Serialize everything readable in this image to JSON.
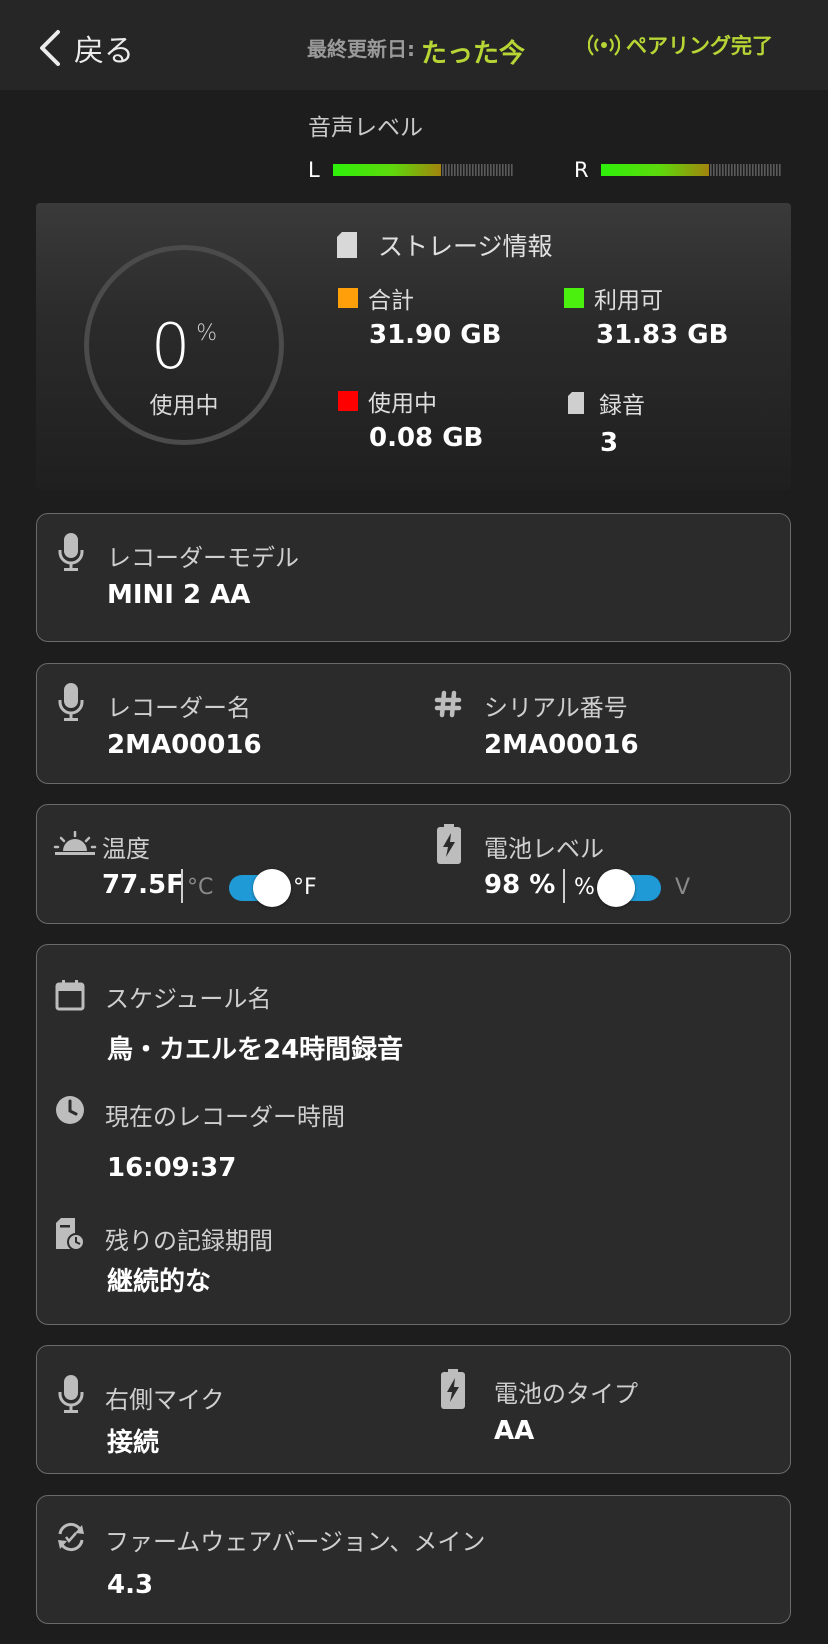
{
  "header": {
    "back_label": "戻る",
    "updated_label": "最終更新日:",
    "updated_value": "たった今",
    "pairing_status": "ペアリング完了",
    "accent_color": "#b7d635"
  },
  "audio": {
    "title": "音声レベル",
    "left_label": "L",
    "right_label": "R",
    "left_level": 0.6,
    "right_level": 0.6
  },
  "storage": {
    "used_percent": "0",
    "percent_unit": "%",
    "used_caption": "使用中",
    "title": "ストレージ情報",
    "total_label": "合計",
    "total_value": "31.90 GB",
    "available_label": "利用可",
    "available_value": "31.83 GB",
    "inuse_label": "使用中",
    "inuse_value": "0.08 GB",
    "recordings_label": "録音",
    "recordings_value": "3",
    "colors": {
      "total": "#ff9f0a",
      "available": "#4cf00f",
      "inuse": "#ff0000"
    }
  },
  "recorder_model": {
    "label": "レコーダーモデル",
    "value": "MINI 2 AA"
  },
  "recorder_name": {
    "label": "レコーダー名",
    "value": "2MA00016"
  },
  "serial": {
    "label": "シリアル番号",
    "value": "2MA00016"
  },
  "temperature": {
    "label": "温度",
    "value": "77.5F",
    "unit_c": "°C",
    "unit_f": "°F",
    "selected": "°F"
  },
  "battery_level": {
    "label": "電池レベル",
    "value": "98 %",
    "unit_pct": "%",
    "unit_v": "V",
    "selected": "%"
  },
  "schedule": {
    "name_label": "スケジュール名",
    "name_value": "鳥・カエルを24時間録音",
    "time_label": "現在のレコーダー時間",
    "time_value": "16:09:37",
    "remaining_label": "残りの記録期間",
    "remaining_value": "継続的な"
  },
  "right_mic": {
    "label": "右側マイク",
    "value": "接続"
  },
  "battery_type": {
    "label": "電池のタイプ",
    "value": "AA"
  },
  "firmware": {
    "label": "ファームウェアバージョン、メイン",
    "value": "4.3"
  },
  "icons": {
    "back": "chevron-left-icon",
    "pairing": "wireless-signal-icon",
    "sd_card": "sd-card-icon",
    "mic": "microphone-icon",
    "hash": "hashtag-icon",
    "sunrise": "sunrise-icon",
    "battery": "battery-charging-icon",
    "calendar": "calendar-icon",
    "clock": "clock-icon",
    "file_clock": "file-clock-icon",
    "firmware": "sync-icon"
  }
}
